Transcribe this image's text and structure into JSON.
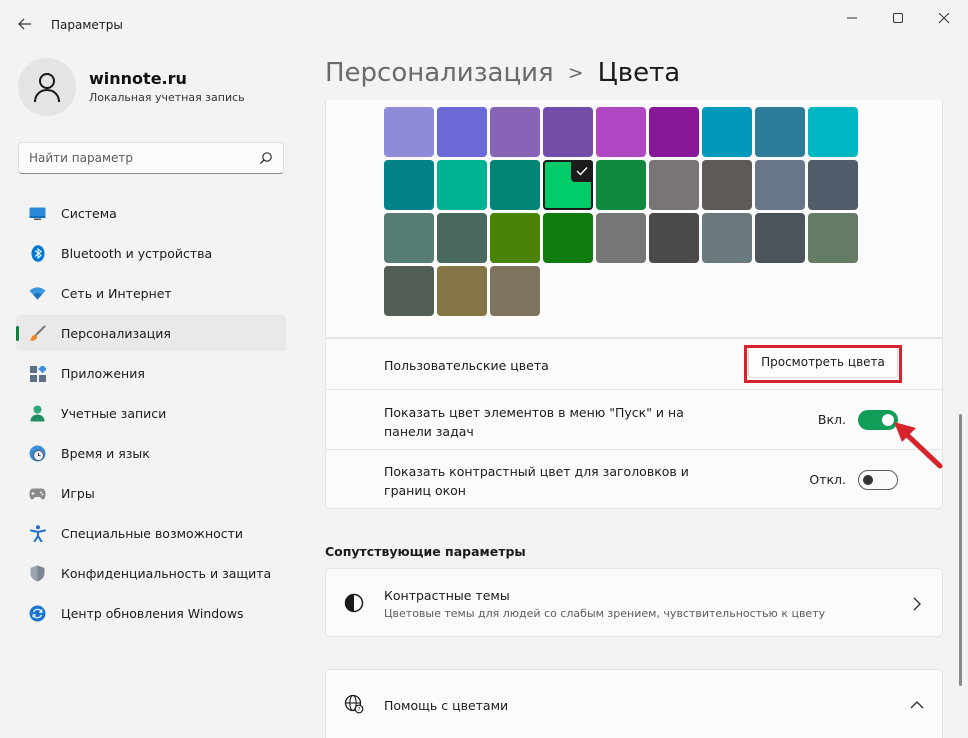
{
  "window": {
    "title": "Параметры",
    "controls": [
      "minimize",
      "maximize",
      "close"
    ]
  },
  "profile": {
    "name": "winnote.ru",
    "account_type": "Локальная учетная запись"
  },
  "search": {
    "placeholder": "Найти параметр"
  },
  "sidebar": {
    "items": [
      {
        "label": "Система",
        "icon": "system-icon",
        "active": false
      },
      {
        "label": "Bluetooth и устройства",
        "icon": "bluetooth-icon",
        "active": false
      },
      {
        "label": "Сеть и Интернет",
        "icon": "network-icon",
        "active": false
      },
      {
        "label": "Персонализация",
        "icon": "brush-icon",
        "active": true
      },
      {
        "label": "Приложения",
        "icon": "apps-icon",
        "active": false
      },
      {
        "label": "Учетные записи",
        "icon": "accounts-icon",
        "active": false
      },
      {
        "label": "Время и язык",
        "icon": "clock-globe-icon",
        "active": false
      },
      {
        "label": "Игры",
        "icon": "gamepad-icon",
        "active": false
      },
      {
        "label": "Специальные возможности",
        "icon": "accessibility-icon",
        "active": false
      },
      {
        "label": "Конфиденциальность и защита",
        "icon": "shield-icon",
        "active": false
      },
      {
        "label": "Центр обновления Windows",
        "icon": "update-icon",
        "active": false
      }
    ]
  },
  "header": {
    "parent": "Персонализация",
    "separator": ">",
    "current": "Цвета"
  },
  "swatches": {
    "rows": [
      [
        "#8e8cd8",
        "#6b69d6",
        "#8764b8",
        "#744da9",
        "#b146c2",
        "#881798",
        "#0099bc",
        "#2d7d9a",
        "#00b7c3"
      ],
      [
        "#038387",
        "#00b294",
        "#018574",
        "#00cc6a",
        "#10893e",
        "#7a7574",
        "#5d5a58",
        "#68768a",
        "#515c6b"
      ],
      [
        "#567c73",
        "#486860",
        "#498205",
        "#107c10",
        "#767676",
        "#4c4a48",
        "#69797e",
        "#4a5459",
        "#647c64"
      ],
      [
        "#525e54",
        "#847545",
        "#7e735f"
      ]
    ],
    "selected_color": "#00cc6a"
  },
  "custom_colors": {
    "label": "Пользовательские цвета",
    "button": "Просмотреть цвета",
    "highlight_color": "#d7242a"
  },
  "start_taskbar_accent": {
    "label_line1": "Показать цвет элементов в меню \"Пуск\" и на",
    "label_line2": "панели задач",
    "state": "Вкл.",
    "on": true
  },
  "title_bar_accent": {
    "label_line1": "Показать контрастный цвет для заголовков и",
    "label_line2": "границ окон",
    "state": "Откл.",
    "on": false
  },
  "related": {
    "title": "Сопутствующие параметры",
    "contrast_themes": {
      "title": "Контрастные темы",
      "subtitle": "Цветовые темы для людей со слабым зрением, чувствительностью к цвету"
    },
    "help": {
      "title": "Помощь с цветами"
    }
  },
  "accent_color": "#0f9d58",
  "annotation_arrow_color": "#d7242a"
}
